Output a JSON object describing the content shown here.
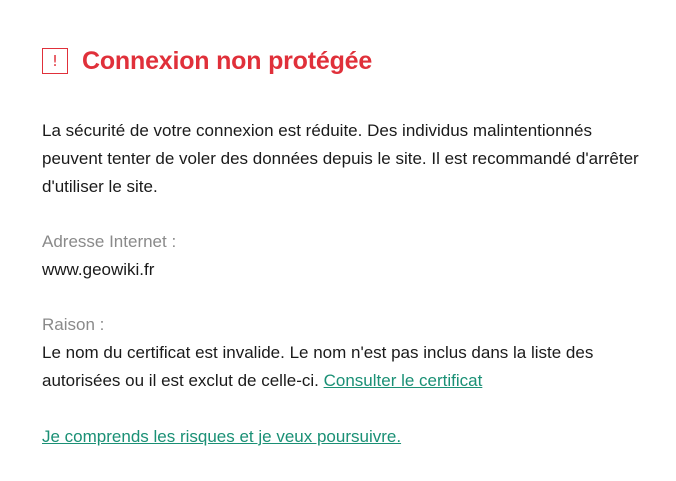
{
  "header": {
    "icon": "warning-square-icon",
    "icon_glyph": "!",
    "title": "Connexion non protégée",
    "accent_color": "#e0303a"
  },
  "description": "La sécurité de votre connexion est réduite. Des individus malintentionnés peuvent tenter de voler des données depuis le site. Il est recommandé d'arrêter d'utiliser le site.",
  "address": {
    "label": "Adresse Internet :",
    "value": "www.geowiki.fr"
  },
  "reason": {
    "label": "Raison :",
    "text": "Le nom du certificat est invalide. Le nom n'est pas inclus dans la liste des autorisées ou il est exclut de celle-ci.",
    "link_label": "Consulter le certificat"
  },
  "proceed_link": "Je comprends les risques et je veux poursuivre.",
  "link_color": "#1a9075"
}
